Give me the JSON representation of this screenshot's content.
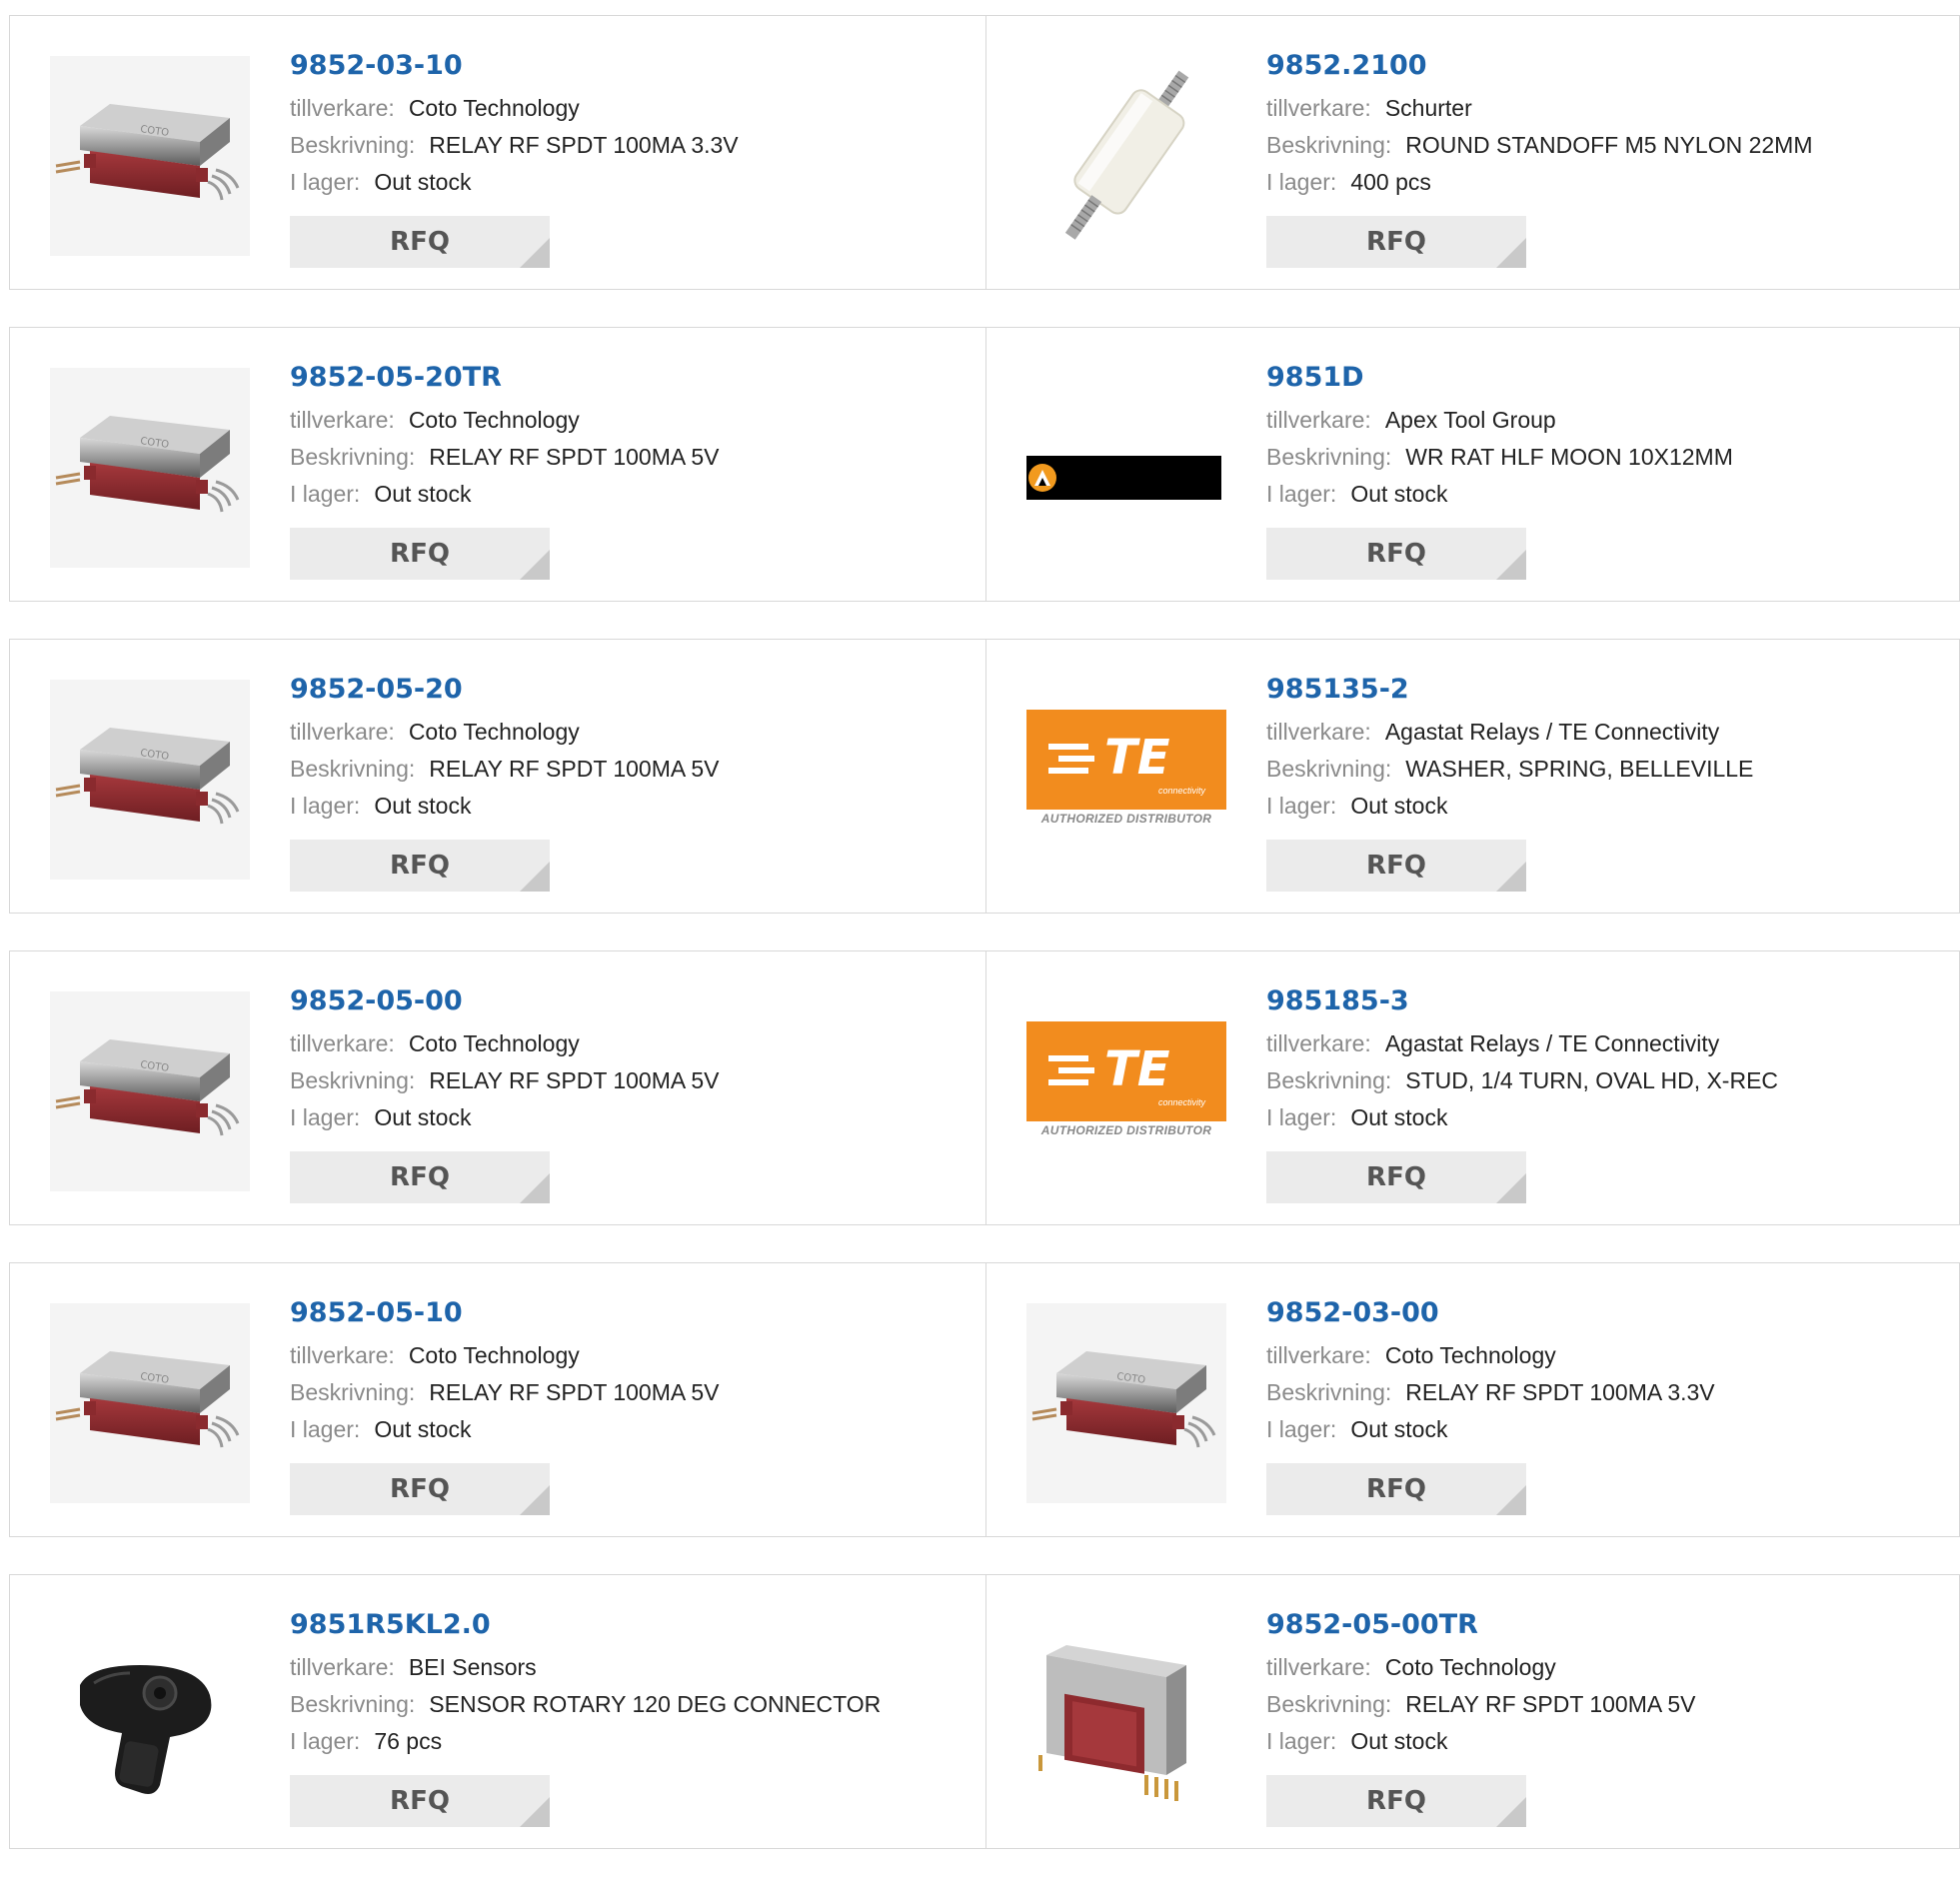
{
  "labels": {
    "manufacturer": "tillverkare:",
    "description": "Beskrivning:",
    "stock": "I lager:",
    "rfq": "RFQ"
  },
  "brand_logos": {
    "te_caption": "AUTHORIZED DISTRIBUTOR",
    "te_wordmark": "TE connectivity"
  },
  "products": [
    {
      "pn": "9852-03-10",
      "manufacturer": "Coto Technology",
      "description": "RELAY RF SPDT 100MA 3.3V",
      "stock": "Out stock",
      "image": "relay"
    },
    {
      "pn": "9852.2100",
      "manufacturer": "Schurter",
      "description": "ROUND STANDOFF M5 NYLON 22MM",
      "stock": "400 pcs",
      "image": "standoff"
    },
    {
      "pn": "9852-05-20TR",
      "manufacturer": "Coto Technology",
      "description": "RELAY RF SPDT 100MA 5V",
      "stock": "Out stock",
      "image": "relay"
    },
    {
      "pn": "9851D",
      "manufacturer": "Apex Tool Group",
      "description": "WR RAT HLF MOON 10X12MM",
      "stock": "Out stock",
      "image": "apex"
    },
    {
      "pn": "9852-05-20",
      "manufacturer": "Coto Technology",
      "description": "RELAY RF SPDT 100MA 5V",
      "stock": "Out stock",
      "image": "relay"
    },
    {
      "pn": "985135-2",
      "manufacturer": "Agastat Relays / TE Connectivity",
      "description": "WASHER, SPRING, BELLEVILLE",
      "stock": "Out stock",
      "image": "te"
    },
    {
      "pn": "9852-05-00",
      "manufacturer": "Coto Technology",
      "description": "RELAY RF SPDT 100MA 5V",
      "stock": "Out stock",
      "image": "relay"
    },
    {
      "pn": "985185-3",
      "manufacturer": "Agastat Relays / TE Connectivity",
      "description": "STUD, 1/4 TURN, OVAL HD, X-REC",
      "stock": "Out stock",
      "image": "te"
    },
    {
      "pn": "9852-05-10",
      "manufacturer": "Coto Technology",
      "description": "RELAY RF SPDT 100MA 5V",
      "stock": "Out stock",
      "image": "relay"
    },
    {
      "pn": "9852-03-00",
      "manufacturer": "Coto Technology",
      "description": "RELAY RF SPDT 100MA 3.3V",
      "stock": "Out stock",
      "image": "relay"
    },
    {
      "pn": "9851R5KL2.0",
      "manufacturer": "BEI Sensors",
      "description": "SENSOR ROTARY 120 DEG CONNECTOR",
      "stock": "76 pcs",
      "image": "sensor"
    },
    {
      "pn": "9852-05-00TR",
      "manufacturer": "Coto Technology",
      "description": "RELAY RF SPDT 100MA 5V",
      "stock": "Out stock",
      "image": "relay"
    }
  ],
  "colors": {
    "link": "#1e64aa",
    "label": "#8a8a8a",
    "button_bg": "#ebebeb",
    "te_orange": "#f28c1e"
  }
}
